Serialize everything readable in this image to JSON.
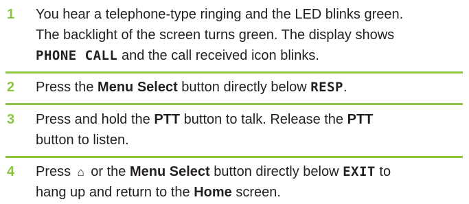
{
  "steps": [
    {
      "number": "1",
      "lines": [
        "You hear a telephone-type ringing and the LED blinks green.",
        "The backlight of the screen turns green. The display shows",
        "and the call received icon blinks."
      ],
      "display_text": "PHONE CALL"
    },
    {
      "number": "2",
      "pre": "Press the ",
      "bold1": "Menu Select",
      "mid": " button directly below ",
      "display_text": "RESP",
      "post": "."
    },
    {
      "number": "3",
      "pre": "Press and hold the ",
      "bold1": "PTT",
      "mid": " button to talk. Release the ",
      "bold2": "PTT",
      "line2": "button to listen."
    },
    {
      "number": "4",
      "pre": "Press ",
      "icon": "home-icon",
      "mid1": " or the ",
      "bold1": "Menu Select",
      "mid2": " button directly below ",
      "display_text": "EXIT",
      "post": " to",
      "line2_pre": "hang up and return to the ",
      "line2_bold": "Home",
      "line2_post": " screen."
    }
  ],
  "colors": {
    "accent": "#8cc63f",
    "text": "#231f20"
  }
}
